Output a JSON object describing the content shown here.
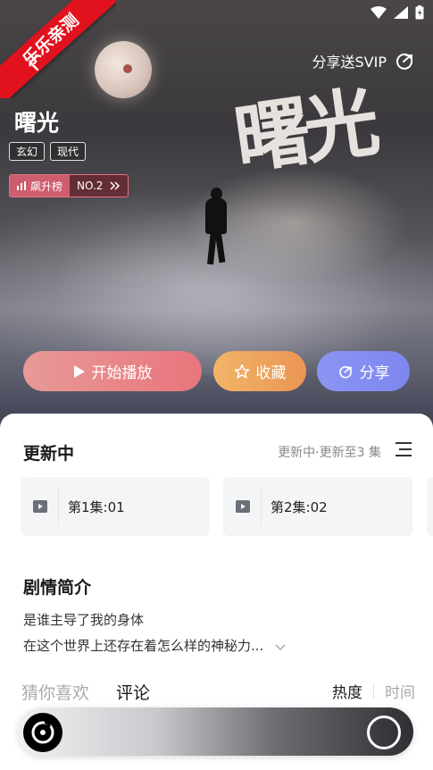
{
  "ribbon": {
    "text": "乐乐亲测"
  },
  "header": {
    "share_vip": "分享送SVIP"
  },
  "hero": {
    "calligraphy": "曙光"
  },
  "show": {
    "title": "曙光",
    "tags": [
      "玄幻",
      "现代"
    ],
    "rank_label": "飙升榜",
    "rank_value": "NO.2"
  },
  "actions": {
    "play": "开始播放",
    "favorite": "收藏",
    "share": "分享"
  },
  "updates": {
    "title": "更新中",
    "meta": "更新中·更新至3 集",
    "episodes": [
      {
        "label": "第1集:01"
      },
      {
        "label": "第2集:02"
      }
    ]
  },
  "synopsis": {
    "title": "剧情简介",
    "line1": "是谁主导了我的身体",
    "line2": "在这个世界上还存在着怎么样的神秘力..."
  },
  "tabs": {
    "guess": "猜你喜欢",
    "comments": "评论"
  },
  "sort": {
    "hot": "热度",
    "time": "时间"
  }
}
